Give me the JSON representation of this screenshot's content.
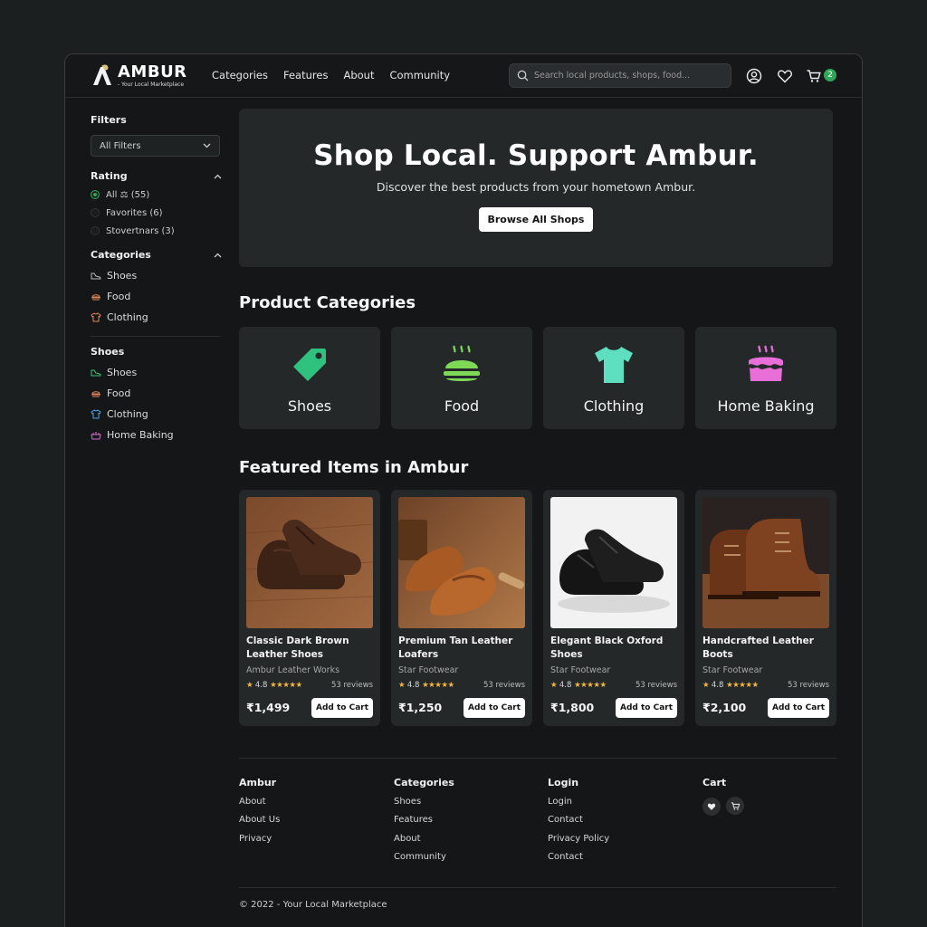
{
  "brand": {
    "name": "AMBUR",
    "tagline": "- Your Local Marketplace"
  },
  "nav": [
    "Categories",
    "Features",
    "About",
    "Community"
  ],
  "search": {
    "placeholder": "Search local products, shops, food..."
  },
  "cart": {
    "count": "2"
  },
  "sidebar": {
    "filters_title": "Filters",
    "filter_select": "All Filters",
    "rating_title": "Rating",
    "rating_options": [
      {
        "label": "All ⚖ (55)",
        "selected": true
      },
      {
        "label": "Favorites (6)",
        "selected": false
      },
      {
        "label": "Stovertnars (3)",
        "selected": false
      }
    ],
    "categories_title": "Categories",
    "categories": [
      "Shoes",
      "Food",
      "Clothing"
    ],
    "shoes_title": "Shoes",
    "shoes_items": [
      "Shoes",
      "Food",
      "Clothing",
      "Home Baking"
    ]
  },
  "hero": {
    "title": "Shop Local. Support Ambur.",
    "subtitle": "Discover the best products from your hometown Ambur.",
    "button": "Browse All Shops"
  },
  "categories_section": {
    "title": "Product Categories",
    "items": [
      {
        "label": "Shoes",
        "icon": "tag-icon",
        "color": "#2ec27e"
      },
      {
        "label": "Food",
        "icon": "food-dish-icon",
        "color": "#7ed957"
      },
      {
        "label": "Clothing",
        "icon": "tshirt-icon",
        "color": "#5ee0c0"
      },
      {
        "label": "Home Baking",
        "icon": "cake-icon",
        "color": "#e86fd8"
      }
    ]
  },
  "featured": {
    "title": "Featured Items in Ambur",
    "products": [
      {
        "name": "Classic Dark Brown Leather Shoes",
        "shop": "Ambur Leather Works",
        "rating": "4.8",
        "reviews": "53 reviews",
        "price": "₹1,499",
        "button": "Add to Cart"
      },
      {
        "name": "Premium Tan Leather Loafers",
        "shop": "Star Footwear",
        "rating": "4.8",
        "reviews": "53 reviews",
        "price": "₹1,250",
        "button": "Add to Cart"
      },
      {
        "name": "Elegant Black Oxford Shoes",
        "shop": "Star Footwear",
        "rating": "4.8",
        "reviews": "53 reviews",
        "price": "₹1,800",
        "button": "Add to Cart"
      },
      {
        "name": "Handcrafted Leather Boots",
        "shop": "Star Footwear",
        "rating": "4.8",
        "reviews": "53 reviews",
        "price": "₹2,100",
        "button": "Add to Cart"
      }
    ]
  },
  "footer": {
    "columns": [
      {
        "title": "Ambur",
        "links": [
          "About",
          "About Us",
          "Privacy"
        ]
      },
      {
        "title": "Categories",
        "links": [
          "Shoes",
          "Features",
          "About",
          "Community"
        ]
      },
      {
        "title": "Login",
        "links": [
          "Login",
          "Contact",
          "Privacy Policy",
          "Contact"
        ]
      },
      {
        "title": "Cart",
        "links": []
      }
    ],
    "copyright": "© 2022 - Your Local Marketplace"
  }
}
